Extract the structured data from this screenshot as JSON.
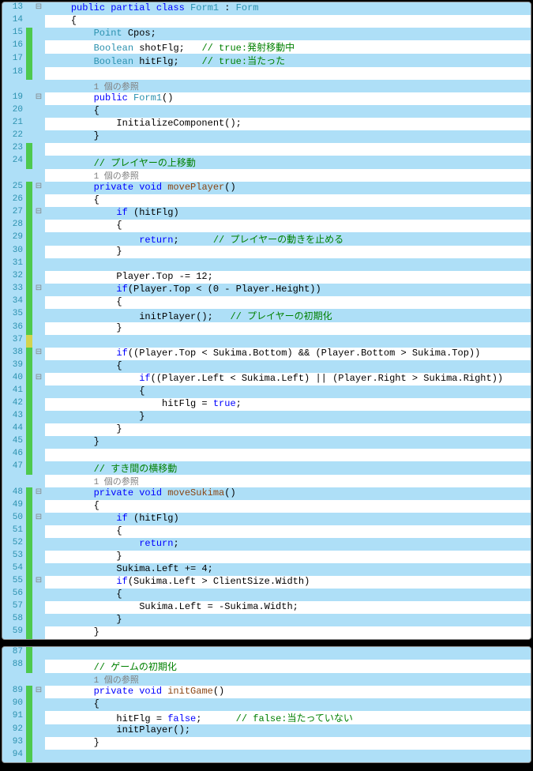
{
  "panel1": {
    "lines": [
      {
        "n": "13",
        "m": "",
        "f": "⊟",
        "html": "    <span class='kw'>public partial class</span> <span class='type'>Form1</span> : <span class='type'>Form</span>"
      },
      {
        "n": "14",
        "m": "",
        "f": "",
        "html": "    {"
      },
      {
        "n": "15",
        "m": "green",
        "f": "",
        "html": "        <span class='type'>Point</span> Cpos;"
      },
      {
        "n": "16",
        "m": "green",
        "f": "",
        "html": "        <span class='type'>Boolean</span> shotFlg;   <span class='comment'>// true:発射移動中</span>"
      },
      {
        "n": "17",
        "m": "green",
        "f": "",
        "html": "        <span class='type'>Boolean</span> hitFlg;    <span class='comment'>// true:当たった</span>"
      },
      {
        "n": "18",
        "m": "green",
        "f": "",
        "html": ""
      },
      {
        "n": "",
        "m": "",
        "f": "",
        "html": "        <span class='ref'>1 個の参照</span>"
      },
      {
        "n": "19",
        "m": "",
        "f": "⊟",
        "html": "        <span class='kw'>public</span> <span class='type'>Form1</span>()"
      },
      {
        "n": "20",
        "m": "",
        "f": "",
        "html": "        {"
      },
      {
        "n": "21",
        "m": "",
        "f": "",
        "html": "            InitializeComponent();"
      },
      {
        "n": "22",
        "m": "",
        "f": "",
        "html": "        }"
      },
      {
        "n": "23",
        "m": "green",
        "f": "",
        "html": ""
      },
      {
        "n": "24",
        "m": "green",
        "f": "",
        "html": "        <span class='comment'>// プレイヤーの上移動</span>"
      },
      {
        "n": "",
        "m": "",
        "f": "",
        "html": "        <span class='ref'>1 個の参照</span>"
      },
      {
        "n": "25",
        "m": "green",
        "f": "⊟",
        "html": "        <span class='kw'>private void</span> <span class='method'>movePlayer</span>()"
      },
      {
        "n": "26",
        "m": "green",
        "f": "",
        "html": "        {"
      },
      {
        "n": "27",
        "m": "green",
        "f": "⊟",
        "html": "            <span class='kw'>if</span> (hitFlg)"
      },
      {
        "n": "28",
        "m": "green",
        "f": "",
        "html": "            {"
      },
      {
        "n": "29",
        "m": "green",
        "f": "",
        "html": "                <span class='kw'>return</span>;      <span class='comment'>// プレイヤーの動きを止める</span>"
      },
      {
        "n": "30",
        "m": "green",
        "f": "",
        "html": "            }"
      },
      {
        "n": "31",
        "m": "green",
        "f": "",
        "html": ""
      },
      {
        "n": "32",
        "m": "green",
        "f": "",
        "html": "            Player.Top -= 12;"
      },
      {
        "n": "33",
        "m": "green",
        "f": "⊟",
        "html": "            <span class='kw'>if</span>(Player.Top < (0 - Player.Height))"
      },
      {
        "n": "34",
        "m": "green",
        "f": "",
        "html": "            {"
      },
      {
        "n": "35",
        "m": "green",
        "f": "",
        "html": "                initPlayer();   <span class='comment'>// プレイヤーの初期化</span>"
      },
      {
        "n": "36",
        "m": "green",
        "f": "",
        "html": "            }"
      },
      {
        "n": "37",
        "m": "yellow",
        "f": "",
        "html": ""
      },
      {
        "n": "38",
        "m": "green",
        "f": "⊟",
        "html": "            <span class='kw'>if</span>((Player.Top < Sukima.Bottom) && (Player.Bottom > Sukima.Top))"
      },
      {
        "n": "39",
        "m": "green",
        "f": "",
        "html": "            {"
      },
      {
        "n": "40",
        "m": "green",
        "f": "⊟",
        "html": "                <span class='kw'>if</span>((Player.Left < Sukima.Left) || (Player.Right > Sukima.Right))"
      },
      {
        "n": "41",
        "m": "green",
        "f": "",
        "html": "                {"
      },
      {
        "n": "42",
        "m": "green",
        "f": "",
        "html": "                    hitFlg = <span class='kw'>true</span>;"
      },
      {
        "n": "43",
        "m": "green",
        "f": "",
        "html": "                }"
      },
      {
        "n": "44",
        "m": "green",
        "f": "",
        "html": "            }"
      },
      {
        "n": "45",
        "m": "green",
        "f": "",
        "html": "        }"
      },
      {
        "n": "46",
        "m": "green",
        "f": "",
        "html": ""
      },
      {
        "n": "47",
        "m": "green",
        "f": "",
        "html": "        <span class='comment'>// すき間の横移動</span>"
      },
      {
        "n": "",
        "m": "",
        "f": "",
        "html": "        <span class='ref'>1 個の参照</span>"
      },
      {
        "n": "48",
        "m": "green",
        "f": "⊟",
        "html": "        <span class='kw'>private void</span> <span class='method'>moveSukima</span>()"
      },
      {
        "n": "49",
        "m": "green",
        "f": "",
        "html": "        {"
      },
      {
        "n": "50",
        "m": "green",
        "f": "⊟",
        "html": "            <span class='kw'>if</span> (hitFlg)"
      },
      {
        "n": "51",
        "m": "green",
        "f": "",
        "html": "            {"
      },
      {
        "n": "52",
        "m": "green",
        "f": "",
        "html": "                <span class='kw'>return</span>;"
      },
      {
        "n": "53",
        "m": "green",
        "f": "",
        "html": "            }"
      },
      {
        "n": "54",
        "m": "green",
        "f": "",
        "html": "            Sukima.Left += 4;"
      },
      {
        "n": "55",
        "m": "green",
        "f": "⊟",
        "html": "            <span class='kw'>if</span>(Sukima.Left > ClientSize.Width)"
      },
      {
        "n": "56",
        "m": "green",
        "f": "",
        "html": "            {"
      },
      {
        "n": "57",
        "m": "green",
        "f": "",
        "html": "                Sukima.Left = -Sukima.Width;"
      },
      {
        "n": "58",
        "m": "green",
        "f": "",
        "html": "            }"
      },
      {
        "n": "59",
        "m": "green",
        "f": "",
        "html": "        }"
      }
    ]
  },
  "panel2": {
    "lines": [
      {
        "n": "87",
        "m": "green",
        "f": "",
        "html": ""
      },
      {
        "n": "88",
        "m": "green",
        "f": "",
        "html": "        <span class='comment'>// ゲームの初期化</span>"
      },
      {
        "n": "",
        "m": "",
        "f": "",
        "html": "        <span class='ref'>1 個の参照</span>"
      },
      {
        "n": "89",
        "m": "green",
        "f": "⊟",
        "html": "        <span class='kw'>private void</span> <span class='method'>initGame</span>()"
      },
      {
        "n": "90",
        "m": "green",
        "f": "",
        "html": "        {"
      },
      {
        "n": "91",
        "m": "green",
        "f": "",
        "html": "            hitFlg = <span class='kw'>false</span>;      <span class='comment'>// false:当たっていない</span>"
      },
      {
        "n": "92",
        "m": "green",
        "f": "",
        "html": "            initPlayer();"
      },
      {
        "n": "93",
        "m": "green",
        "f": "",
        "html": "        }"
      },
      {
        "n": "94",
        "m": "green",
        "f": "",
        "html": ""
      }
    ]
  }
}
